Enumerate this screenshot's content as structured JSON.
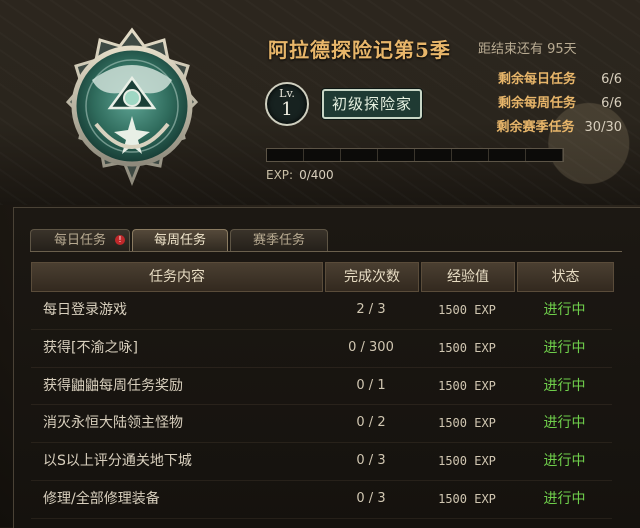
{
  "header": {
    "season_title": "阿拉德探险记第5季",
    "season_remaining": "距结束还有 95天",
    "level_label": "Lv.",
    "level_value": "1",
    "rank_title": "初级探险家",
    "remaining": [
      {
        "label": "剩余每日任务",
        "value": "6/6"
      },
      {
        "label": "剩余每周任务",
        "value": "6/6"
      },
      {
        "label": "剩余赛季任务",
        "value": "30/30"
      }
    ],
    "exp_label": "EXP:",
    "exp_value": "0/400",
    "exp_progress": 0
  },
  "tabs": [
    {
      "label": "每日任务",
      "active": false,
      "alert": true
    },
    {
      "label": "每周任务",
      "active": true,
      "alert": false
    },
    {
      "label": "赛季任务",
      "active": false,
      "alert": false
    }
  ],
  "alert_symbol": "!",
  "table": {
    "columns": [
      "任务内容",
      "完成次数",
      "经验值",
      "状态"
    ],
    "rows": [
      {
        "name": "每日登录游戏",
        "count": "2 / 3",
        "exp": "1500 EXP",
        "state": "进行中"
      },
      {
        "name": "获得[不渝之咏]",
        "count": "0 / 300",
        "exp": "1500 EXP",
        "state": "进行中"
      },
      {
        "name": "获得鼬鼬每周任务奖励",
        "count": "0 / 1",
        "exp": "1500 EXP",
        "state": "进行中"
      },
      {
        "name": "消灭永恒大陆领主怪物",
        "count": "0 / 2",
        "exp": "1500 EXP",
        "state": "进行中"
      },
      {
        "name": "以S以上评分通关地下城",
        "count": "0 / 3",
        "exp": "1500 EXP",
        "state": "进行中"
      },
      {
        "name": "修理/全部修理装备",
        "count": "0 / 3",
        "exp": "1500 EXP",
        "state": "进行中"
      }
    ]
  },
  "colors": {
    "accent": "#e8b66a",
    "state_green": "#6fcf4b",
    "emblem_teal": "#2f6b5c"
  },
  "icons": [
    "season-emblem-icon",
    "level-badge-icon"
  ]
}
